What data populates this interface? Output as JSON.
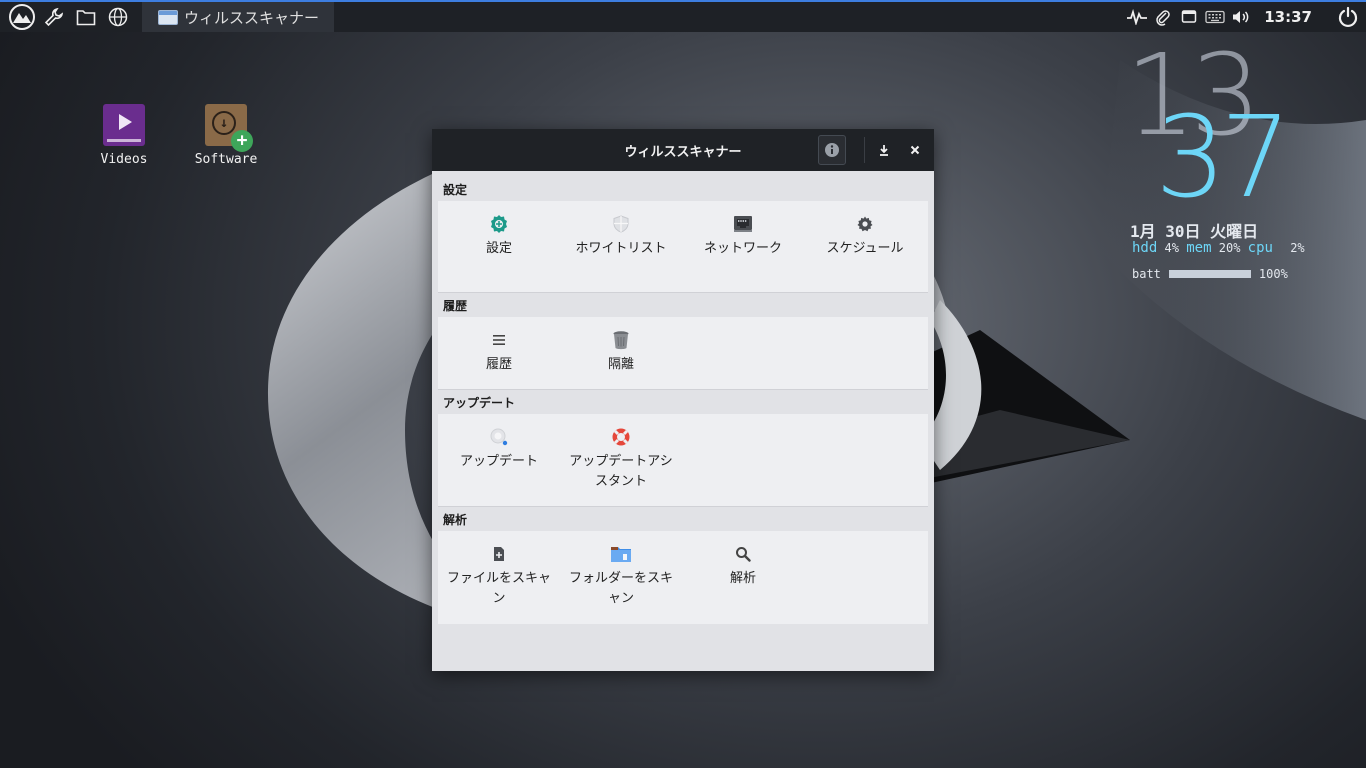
{
  "taskbar": {
    "active_window_label": "ウィルススキャナー"
  },
  "tray": {
    "clock": "13:37"
  },
  "desktop": {
    "icons": [
      {
        "label": "Videos"
      },
      {
        "label": "Software"
      }
    ]
  },
  "conky": {
    "hour": "13",
    "minute": "37",
    "date": "1月 30日 火曜日",
    "hdd_label": "hdd",
    "hdd_value": "4%",
    "mem_label": "mem",
    "mem_value": "20%",
    "cpu_label": "cpu",
    "cpu_value": "2%",
    "batt_label": "batt",
    "batt_value": "100%",
    "batt_level": 1.0
  },
  "window": {
    "title": "ウィルススキャナー",
    "sections": [
      {
        "heading": "設定",
        "items": [
          {
            "label": "設定",
            "icon": "gear-shield-icon"
          },
          {
            "label": "ホワイトリスト",
            "icon": "shield-icon"
          },
          {
            "label": "ネットワーク",
            "icon": "network-icon"
          },
          {
            "label": "スケジュール",
            "icon": "cog-icon"
          }
        ]
      },
      {
        "heading": "履歴",
        "items": [
          {
            "label": "履歴",
            "icon": "list-icon"
          },
          {
            "label": "隔離",
            "icon": "trash-icon"
          }
        ]
      },
      {
        "heading": "アップデート",
        "items": [
          {
            "label": "アップデート",
            "icon": "update-icon"
          },
          {
            "label": "アップデートアシスタント",
            "icon": "lifebuoy-icon"
          }
        ]
      },
      {
        "heading": "解析",
        "items": [
          {
            "label": "ファイルをスキャン",
            "icon": "file-add-icon"
          },
          {
            "label": "フォルダーをスキャン",
            "icon": "folder-icon"
          },
          {
            "label": "解析",
            "icon": "search-icon"
          }
        ]
      }
    ]
  },
  "colors": {
    "panel_accent": "#3d7ee0",
    "conky_accent": "#6dd6f7",
    "window_bg": "#e1e2e6",
    "titlebar_bg": "#1f2226"
  }
}
